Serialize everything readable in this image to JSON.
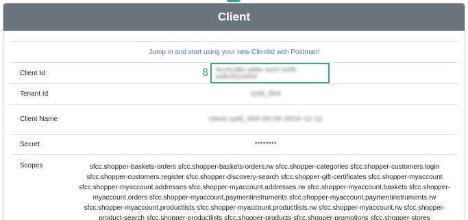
{
  "header": {
    "title": "Client"
  },
  "postman_link": "Jump in and start using your new ClientId with Postman!",
  "rows": {
    "client_id": {
      "label": "Client Id",
      "value": "9cc0c38e-a88e-4a10-b4f8-ed8c5f1d3f44",
      "step": "8"
    },
    "tenant_id": {
      "label": "Tenant Id",
      "value": "zyld_004"
    },
    "client_name": {
      "label": "Client Name",
      "value": "client-zyld_004-04-04-2024-12-12"
    },
    "secret": {
      "label": "Secret",
      "value": "********"
    },
    "scopes": {
      "label": "Scopes",
      "value": "sfcc.shopper-baskets-orders sfcc.shopper-baskets-orders.rw sfcc.shopper-categories sfcc.shopper-customers.login sfcc.shopper-customers.register sfcc.shopper-discovery-search sfcc.shopper-gift-certificates sfcc.shopper-myaccount sfcc.shopper-myaccount.addresses sfcc.shopper-myaccount.addresses.rw sfcc.shopper-myaccount.baskets sfcc.shopper-myaccount.orders sfcc.shopper-myaccount.paymentinstruments sfcc.shopper-myaccount.paymentinstruments.rw sfcc.shopper-myaccount.productlists sfcc.shopper-myaccount.productlists.rw sfcc.shopper-myaccount.rw sfcc.shopper-product-search sfcc.shopper-productlists sfcc.shopper-products sfcc.shopper-promotions sfcc.shopper-stores"
    }
  },
  "colors": {
    "header_bg": "#6c757d",
    "link": "#4a74d8",
    "highlight": "#3ea08b"
  }
}
